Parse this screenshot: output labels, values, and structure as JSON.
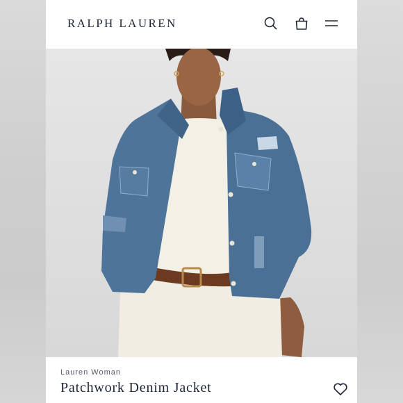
{
  "header": {
    "brand": "RALPH LAUREN",
    "icons": [
      "search-icon",
      "shopping-bag-icon",
      "menu-icon"
    ]
  },
  "hero": {
    "image": "model-wearing-patchwork-denim-jacket"
  },
  "product": {
    "subbrand": "Lauren Woman",
    "name": "Patchwork Denim Jacket",
    "favorite_icon": "heart-icon"
  },
  "colors": {
    "brand_navy": "#1c2433",
    "denim": "#4b7096",
    "page_bg": "#ffffff"
  }
}
